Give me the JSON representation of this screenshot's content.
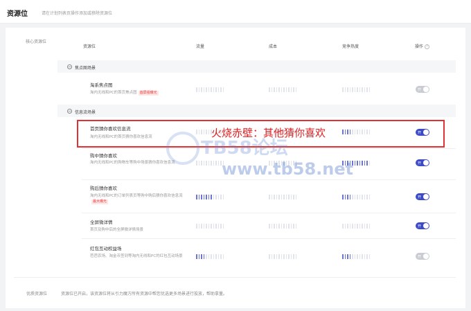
{
  "header": {
    "title": "资源位",
    "hint": "请在计划列表页操作添加或移除资源位"
  },
  "sections": {
    "core": "核心资源位",
    "quality": "优质资源位"
  },
  "columns": {
    "resource": "资源位",
    "traffic": "流量",
    "cost": "成本",
    "competition": "竞争热度",
    "action": "操作",
    "help_icon": "?"
  },
  "groups": [
    {
      "toggle": "−",
      "label": "焦点图场景"
    },
    {
      "toggle": "−",
      "label": "信息流场景"
    }
  ],
  "rows": [
    {
      "title": "淘系焦点图",
      "desc": "淘内无线和PC的首页焦点图",
      "tag": "首屏强曝光",
      "traffic": 0,
      "cost": 0,
      "competition": 0,
      "switch": "开",
      "on": false
    },
    {
      "title": "首页猜你喜欢信息流",
      "desc": "淘内无线和PC的首页猜你喜欢信息流",
      "tag": "",
      "traffic": 0,
      "cost": 0,
      "competition": 0.3,
      "switch": "开",
      "on": true
    },
    {
      "title": "购中猜你喜欢",
      "desc": "淘内无线和PC的购物车等购中场景猜你喜欢信息流",
      "tag": "",
      "traffic": 0,
      "cost": 0,
      "competition": 0.9,
      "switch": "开",
      "on": true
    },
    {
      "title": "购后猜你喜欢",
      "desc": "淘内无线和PC的订单列表页等购中购后猜你喜欢信息流",
      "tag": "最大曝光",
      "traffic": 0.6,
      "cost": 0,
      "competition": 0.3,
      "switch": "开",
      "on": true
    },
    {
      "title": "全屏微详情",
      "desc": "首页及购中后的全屏微详情场景",
      "tag": "",
      "traffic": 0,
      "cost": 0,
      "competition": 0,
      "switch": "开",
      "on": true
    },
    {
      "title": "红包互动权益场",
      "desc": "芭芭农场、淘金币签到等淘内无线和PC的红包互动场景",
      "tag": "",
      "traffic": 0.3,
      "cost": 0,
      "competition": 0.3,
      "switch": "开",
      "on": false
    }
  ],
  "overlay": {
    "caption": "火烧赤壁：其他猜你喜欢",
    "watermark_logo": "TB58论坛",
    "watermark_url": "www.tb58.net"
  },
  "footer": {
    "text": "资源位已开启，该资源位将从引力魔方所有资源中帮您优选更多场景进行投放，帮助拿量。"
  },
  "colors": {
    "accent": "#3d4bc7",
    "meter_on": "#6a73d6",
    "highlight": "#e03232"
  }
}
